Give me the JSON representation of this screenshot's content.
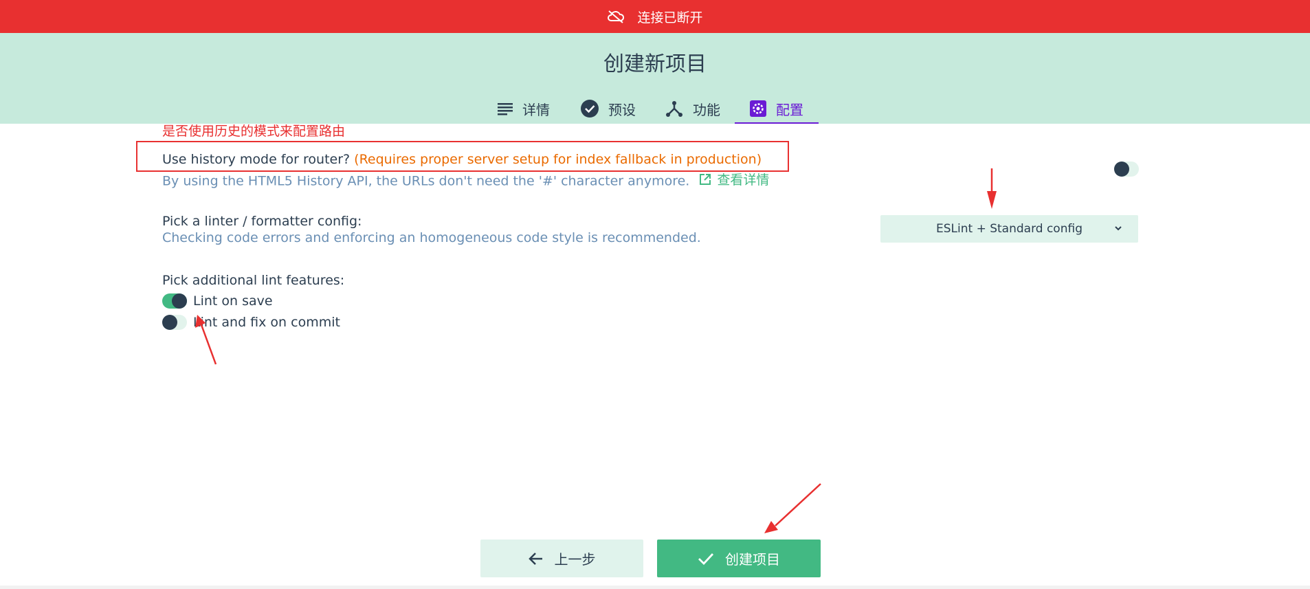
{
  "banner": {
    "icon": "cloud-off-icon",
    "text": "连接已断开",
    "color": "#e83030"
  },
  "header": {
    "title": "创建新项目",
    "tabs": [
      {
        "label": "详情",
        "icon": "list-icon"
      },
      {
        "label": "预设",
        "icon": "check-circle-icon"
      },
      {
        "label": "功能",
        "icon": "fork-icon"
      },
      {
        "label": "配置",
        "icon": "gear-icon",
        "active": true
      }
    ]
  },
  "annotation": {
    "title": "是否使用历史的模式来配置路由"
  },
  "history": {
    "question": "Use history mode for router?",
    "warning": "(Requires proper server setup for index fallback in production)",
    "description": "By using the HTML5 History API, the URLs don't need the '#' character anymore.",
    "link": "查看详情",
    "enabled": false
  },
  "linter": {
    "question": "Pick a linter / formatter config:",
    "description": "Checking code errors and enforcing an homogeneous code style is recommended.",
    "selected": "ESLint + Standard config"
  },
  "lint_features": {
    "question": "Pick additional lint features:",
    "items": [
      {
        "label": "Lint on save",
        "enabled": true
      },
      {
        "label": "Lint and fix on commit",
        "enabled": false
      }
    ]
  },
  "buttons": {
    "prev": "上一步",
    "create": "创建项目"
  },
  "colors": {
    "accent": "#42b983",
    "active_tab": "#6a1bd4",
    "header_bg": "#c6eadc",
    "warning": "#ea6a00"
  }
}
